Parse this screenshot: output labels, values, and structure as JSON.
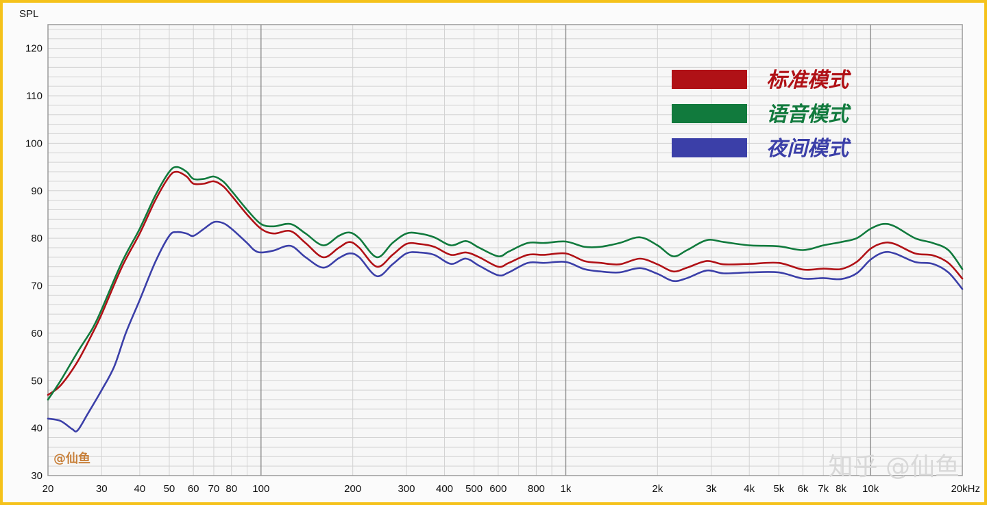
{
  "chart_data": {
    "type": "line",
    "ylabel": "SPL",
    "xlabel": "",
    "x_scale": "log",
    "xlim": [
      20,
      20000
    ],
    "ylim": [
      30,
      125
    ],
    "grid": true,
    "legend_position": "top-right",
    "y_ticks": [
      30,
      40,
      50,
      60,
      70,
      80,
      90,
      100,
      110,
      120
    ],
    "x_ticks": [
      {
        "value": 20,
        "label": "20"
      },
      {
        "value": 30,
        "label": "30"
      },
      {
        "value": 40,
        "label": "40"
      },
      {
        "value": 50,
        "label": "50"
      },
      {
        "value": 60,
        "label": "60"
      },
      {
        "value": 70,
        "label": "70"
      },
      {
        "value": 80,
        "label": "80"
      },
      {
        "value": 100,
        "label": "100"
      },
      {
        "value": 200,
        "label": "200"
      },
      {
        "value": 300,
        "label": "300"
      },
      {
        "value": 400,
        "label": "400"
      },
      {
        "value": 500,
        "label": "500"
      },
      {
        "value": 600,
        "label": "600"
      },
      {
        "value": 800,
        "label": "800"
      },
      {
        "value": 1000,
        "label": "1k"
      },
      {
        "value": 2000,
        "label": "2k"
      },
      {
        "value": 3000,
        "label": "3k"
      },
      {
        "value": 4000,
        "label": "4k"
      },
      {
        "value": 5000,
        "label": "5k"
      },
      {
        "value": 6000,
        "label": "6k"
      },
      {
        "value": 7000,
        "label": "7k"
      },
      {
        "value": 8000,
        "label": "8k"
      },
      {
        "value": 10000,
        "label": "10k"
      },
      {
        "value": 20000,
        "label": "20kHz"
      }
    ],
    "series": [
      {
        "name": "标准模式",
        "color": "#b01116",
        "points": [
          [
            20,
            47
          ],
          [
            22,
            49
          ],
          [
            25,
            54
          ],
          [
            28,
            60
          ],
          [
            30,
            64
          ],
          [
            35,
            74
          ],
          [
            40,
            81
          ],
          [
            45,
            88
          ],
          [
            50,
            93
          ],
          [
            53,
            94
          ],
          [
            57,
            93
          ],
          [
            60,
            91.5
          ],
          [
            65,
            91.5
          ],
          [
            70,
            92
          ],
          [
            75,
            91
          ],
          [
            80,
            89
          ],
          [
            90,
            85
          ],
          [
            100,
            82
          ],
          [
            110,
            81
          ],
          [
            125,
            81.5
          ],
          [
            140,
            79
          ],
          [
            160,
            76
          ],
          [
            180,
            78
          ],
          [
            195,
            79.2
          ],
          [
            210,
            78
          ],
          [
            240,
            74
          ],
          [
            270,
            76.5
          ],
          [
            300,
            78.8
          ],
          [
            330,
            78.8
          ],
          [
            370,
            78.2
          ],
          [
            420,
            76.5
          ],
          [
            470,
            77
          ],
          [
            520,
            76
          ],
          [
            600,
            74
          ],
          [
            650,
            74.8
          ],
          [
            750,
            76.5
          ],
          [
            850,
            76.5
          ],
          [
            1000,
            76.8
          ],
          [
            1150,
            75.2
          ],
          [
            1300,
            74.8
          ],
          [
            1500,
            74.5
          ],
          [
            1750,
            75.7
          ],
          [
            2000,
            74.5
          ],
          [
            2250,
            73
          ],
          [
            2500,
            73.8
          ],
          [
            2900,
            75.2
          ],
          [
            3300,
            74.5
          ],
          [
            4000,
            74.6
          ],
          [
            5000,
            74.8
          ],
          [
            6000,
            73.4
          ],
          [
            7000,
            73.6
          ],
          [
            8000,
            73.5
          ],
          [
            9000,
            75
          ],
          [
            10000,
            77.8
          ],
          [
            11000,
            79
          ],
          [
            12000,
            78.8
          ],
          [
            14000,
            76.8
          ],
          [
            16000,
            76.4
          ],
          [
            18000,
            74.8
          ],
          [
            20000,
            71.5
          ]
        ]
      },
      {
        "name": "语音模式",
        "color": "#117a3d",
        "points": [
          [
            20,
            46
          ],
          [
            22,
            50
          ],
          [
            25,
            56
          ],
          [
            28,
            61
          ],
          [
            30,
            65
          ],
          [
            35,
            75
          ],
          [
            40,
            82
          ],
          [
            45,
            89
          ],
          [
            50,
            94
          ],
          [
            53,
            95
          ],
          [
            57,
            94
          ],
          [
            60,
            92.5
          ],
          [
            65,
            92.5
          ],
          [
            70,
            93
          ],
          [
            75,
            92
          ],
          [
            80,
            90
          ],
          [
            90,
            86
          ],
          [
            100,
            83
          ],
          [
            110,
            82.5
          ],
          [
            125,
            83
          ],
          [
            140,
            81
          ],
          [
            160,
            78.5
          ],
          [
            180,
            80.5
          ],
          [
            195,
            81.2
          ],
          [
            210,
            80
          ],
          [
            240,
            76
          ],
          [
            270,
            79
          ],
          [
            300,
            81
          ],
          [
            330,
            81
          ],
          [
            370,
            80.2
          ],
          [
            420,
            78.5
          ],
          [
            470,
            79.4
          ],
          [
            520,
            78
          ],
          [
            600,
            76.2
          ],
          [
            650,
            77.2
          ],
          [
            750,
            79
          ],
          [
            850,
            79
          ],
          [
            1000,
            79.3
          ],
          [
            1150,
            78.2
          ],
          [
            1300,
            78.2
          ],
          [
            1500,
            79
          ],
          [
            1750,
            80.2
          ],
          [
            2000,
            78.5
          ],
          [
            2250,
            76.2
          ],
          [
            2500,
            77.5
          ],
          [
            2900,
            79.6
          ],
          [
            3300,
            79.2
          ],
          [
            4000,
            78.5
          ],
          [
            5000,
            78.3
          ],
          [
            6000,
            77.5
          ],
          [
            7000,
            78.5
          ],
          [
            8000,
            79.2
          ],
          [
            9000,
            80
          ],
          [
            10000,
            82
          ],
          [
            11000,
            83
          ],
          [
            12000,
            82.5
          ],
          [
            14000,
            80
          ],
          [
            16000,
            79
          ],
          [
            18000,
            77.5
          ],
          [
            20000,
            73.5
          ]
        ]
      },
      {
        "name": "夜间模式",
        "color": "#3b3fa8",
        "points": [
          [
            20,
            42
          ],
          [
            22,
            41.5
          ],
          [
            24,
            39.8
          ],
          [
            25,
            39.5
          ],
          [
            27,
            43
          ],
          [
            30,
            48
          ],
          [
            33,
            53
          ],
          [
            36,
            60
          ],
          [
            40,
            67
          ],
          [
            45,
            75
          ],
          [
            50,
            80.5
          ],
          [
            53,
            81.3
          ],
          [
            57,
            81
          ],
          [
            60,
            80.5
          ],
          [
            65,
            82
          ],
          [
            70,
            83.4
          ],
          [
            75,
            83.2
          ],
          [
            80,
            82
          ],
          [
            90,
            79
          ],
          [
            95,
            77.5
          ],
          [
            100,
            77
          ],
          [
            110,
            77.4
          ],
          [
            125,
            78.4
          ],
          [
            140,
            76
          ],
          [
            160,
            73.8
          ],
          [
            180,
            75.8
          ],
          [
            195,
            76.8
          ],
          [
            210,
            76
          ],
          [
            240,
            72
          ],
          [
            270,
            74.5
          ],
          [
            300,
            76.8
          ],
          [
            330,
            77
          ],
          [
            370,
            76.5
          ],
          [
            420,
            74.6
          ],
          [
            470,
            75.7
          ],
          [
            520,
            74.2
          ],
          [
            600,
            72.2
          ],
          [
            650,
            72.8
          ],
          [
            750,
            74.8
          ],
          [
            850,
            74.8
          ],
          [
            1000,
            75
          ],
          [
            1150,
            73.5
          ],
          [
            1300,
            73
          ],
          [
            1500,
            72.8
          ],
          [
            1750,
            73.7
          ],
          [
            2000,
            72.5
          ],
          [
            2250,
            71
          ],
          [
            2500,
            71.6
          ],
          [
            2900,
            73.2
          ],
          [
            3300,
            72.6
          ],
          [
            4000,
            72.8
          ],
          [
            5000,
            72.8
          ],
          [
            6000,
            71.5
          ],
          [
            7000,
            71.6
          ],
          [
            8000,
            71.4
          ],
          [
            9000,
            72.6
          ],
          [
            10000,
            75.5
          ],
          [
            11000,
            77
          ],
          [
            12000,
            76.8
          ],
          [
            14000,
            75
          ],
          [
            16000,
            74.6
          ],
          [
            18000,
            72.8
          ],
          [
            20000,
            69.3
          ]
        ]
      }
    ]
  },
  "credit": "@仙鱼",
  "watermark": "知乎 @仙鱼",
  "colors": {
    "frame": "#f5c21b",
    "plot_bg": "#f7f7f7",
    "grid_minor": "#d2d2d2",
    "grid_major": "#8a8a8a",
    "credit": "#c8803a",
    "watermark": "#d8d8d8"
  }
}
